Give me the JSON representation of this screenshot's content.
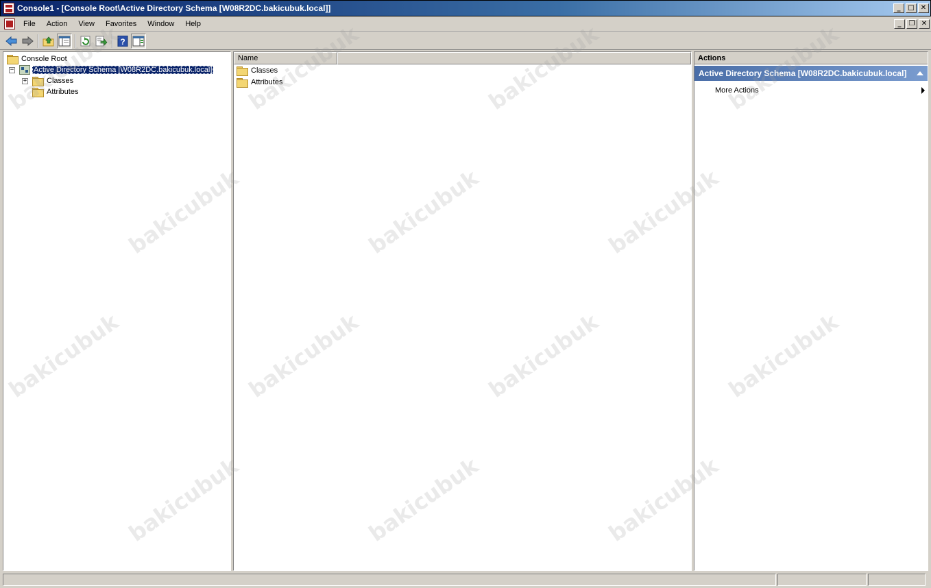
{
  "window": {
    "title": "Console1 - [Console Root\\Active Directory Schema [W08R2DC.bakicubuk.local]]",
    "controls": {
      "minimize": "_",
      "maximize": "□",
      "close": "✕"
    }
  },
  "menu": {
    "items": [
      "File",
      "Action",
      "View",
      "Favorites",
      "Window",
      "Help"
    ],
    "mdi_controls": {
      "minimize": "_",
      "restore": "❐",
      "close": "✕"
    }
  },
  "toolbar": {
    "icons": [
      "back-arrow-icon",
      "forward-arrow-icon",
      "up-folder-icon",
      "show-hide-tree-icon",
      "refresh-icon",
      "export-list-icon",
      "help-icon",
      "show-hide-action-pane-icon"
    ]
  },
  "tree": {
    "root": "Console Root",
    "schema_node": "Active Directory Schema [W08R2DC.bakicubuk.local]",
    "children": [
      "Classes",
      "Attributes"
    ],
    "expander_collapsed": "+",
    "expander_expanded": "−"
  },
  "list": {
    "columns": [
      "Name"
    ],
    "rows": [
      "Classes",
      "Attributes"
    ]
  },
  "actions": {
    "header": "Actions",
    "section_title": "Active Directory Schema [W08R2DC.bakicubuk.local]",
    "items": [
      "More Actions"
    ]
  },
  "watermark": "bakicubuk",
  "colors": {
    "chrome": "#d4d0c8",
    "titlebar": "#0a246a",
    "selection": "#0a246a",
    "actions_section": "#4a6ea8"
  }
}
